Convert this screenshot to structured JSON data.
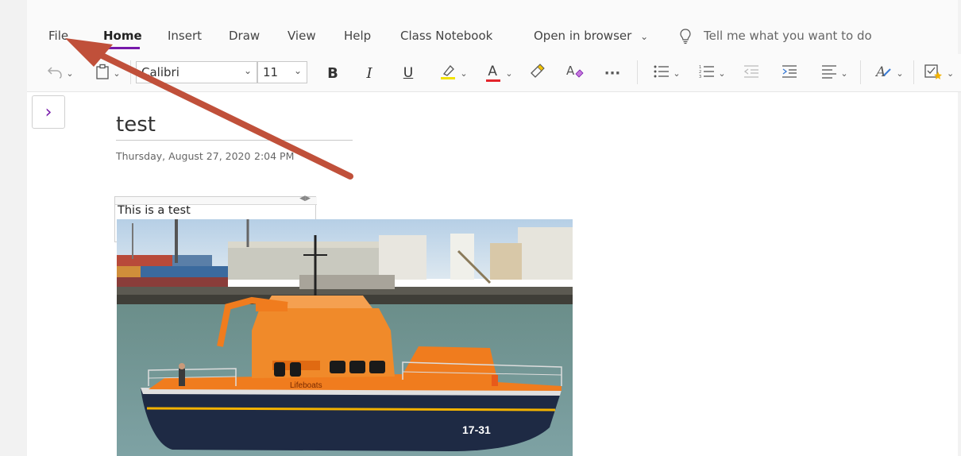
{
  "menu": {
    "file": "File",
    "home": "Home",
    "insert": "Insert",
    "draw": "Draw",
    "view": "View",
    "help": "Help",
    "class_notebook": "Class Notebook",
    "open_in_browser": "Open in browser",
    "tell_me": "Tell me what you want to do"
  },
  "ribbon": {
    "font_name": "Calibri",
    "font_size": "11",
    "bold": "B",
    "italic": "I",
    "underline": "U",
    "font_color_letter": "A",
    "more": "···"
  },
  "page": {
    "title": "test",
    "date": "Thursday, August 27, 2020",
    "time": "2:04 PM",
    "note_text": "This is a test"
  },
  "photo": {
    "boat_label": "Lifeboats",
    "hull_number": "17-31"
  },
  "colors": {
    "accent": "#7719aa",
    "arrow": "#c0503a",
    "highlight_yellow": "#f2e200",
    "font_red": "#e3242b",
    "boat_orange": "#f07c1e",
    "hull_navy": "#1e2a44"
  },
  "icons": {
    "undo": "undo-icon",
    "clipboard": "clipboard-icon",
    "highlighter": "highlighter-icon",
    "format_painter": "format-painter-icon",
    "clear_formatting": "clear-formatting-icon",
    "bullets": "bulleted-list-icon",
    "numbering": "numbered-list-icon",
    "outdent": "outdent-icon",
    "indent": "indent-icon",
    "align": "paragraph-align-icon",
    "styles": "styles-icon",
    "tag": "tag-icon",
    "lightbulb": "lightbulb-icon"
  }
}
